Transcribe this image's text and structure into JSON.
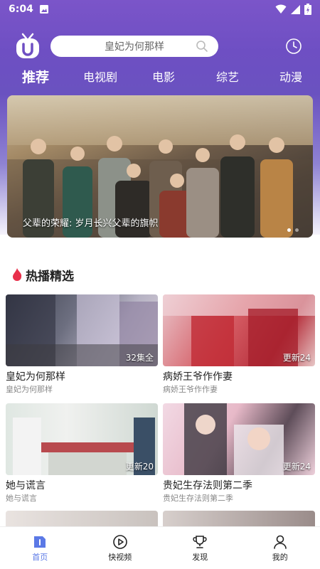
{
  "status_bar": {
    "time": "6:04"
  },
  "search": {
    "query": "皇妃为何那样"
  },
  "nav_tabs": [
    "推荐",
    "电视剧",
    "电影",
    "综艺",
    "动漫"
  ],
  "banner": {
    "caption": "父辈的荣耀: 岁月长兴父辈的旗帜"
  },
  "section": {
    "title": "热播精选"
  },
  "cards": [
    {
      "title": "皇妃为何那样",
      "subtitle": "皇妃为何那样",
      "badge": "32集全"
    },
    {
      "title": "病娇王爷作作妻",
      "subtitle": "病娇王爷作作妻",
      "badge": "更新24"
    },
    {
      "title": "她与谎言",
      "subtitle": "她与谎言",
      "badge": "更新20"
    },
    {
      "title": "贵妃生存法则第二季",
      "subtitle": "贵妃生存法则第二季",
      "badge": "更新24"
    }
  ],
  "bottom_nav": [
    "首页",
    "快视频",
    "发现",
    "我的"
  ],
  "colors": {
    "accent": "#5b79e6",
    "header_purple": "#6e4fc3",
    "flame": "#e8304b"
  },
  "icons": {
    "logo": "tv-logo-icon",
    "search": "search-icon",
    "history": "clock-icon",
    "section": "flame-icon"
  }
}
